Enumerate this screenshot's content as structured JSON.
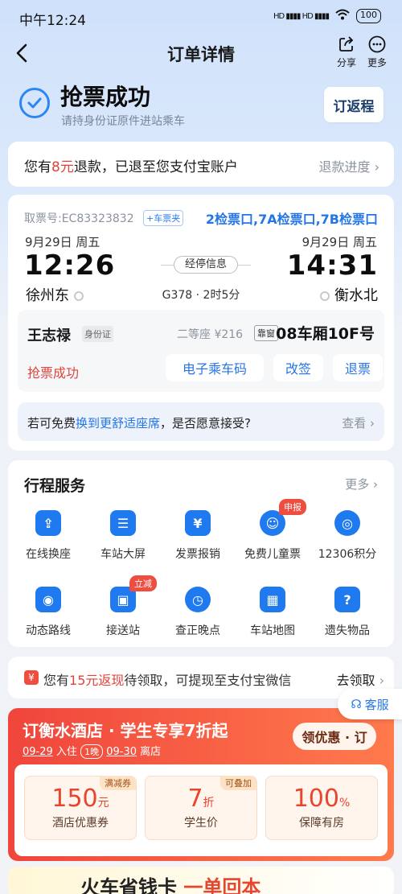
{
  "status_bar": {
    "time": "中午12:24",
    "signal": "HD ▮▮▮▮ HD ▮▮▮▮",
    "battery": "100"
  },
  "nav": {
    "title": "订单详情",
    "share": "分享",
    "more": "更多"
  },
  "header": {
    "title": "抢票成功",
    "subtitle": "请持身份证原件进站乘车",
    "return_button": "订返程"
  },
  "refund": {
    "prefix": "您有",
    "amount": "8元",
    "suffix": "退款，已退至您支付宝账户",
    "link": "退款进度"
  },
  "ticket": {
    "ticket_no": "取票号:EC83323832",
    "wallet_tag": "+车票夹",
    "gate": "2检票口,7A检票口,7B检票口",
    "depart": {
      "date": "9月29日  周五",
      "time": "12:26",
      "station": "徐州东"
    },
    "arrive": {
      "date": "9月29日  周五",
      "time": "14:31",
      "station": "衡水北"
    },
    "stops_label": "经停信息",
    "train_info": "G378 · 2时5分",
    "passenger": {
      "name": "王志禄",
      "id_type": "身份证",
      "seat_type": "二等座 ¥216",
      "window_tag": "靠窗",
      "seat_no": "08车厢10F号",
      "status": "抢票成功",
      "btn_eticket": "电子乘车码",
      "btn_change": "改签",
      "btn_refund": "退票"
    },
    "upgrade": {
      "pre": "若可免费",
      "highlight": "换到更舒适座席",
      "post": "，是否愿意接受?",
      "link": "查看"
    }
  },
  "services": {
    "title": "行程服务",
    "more": "更多",
    "items": [
      {
        "label": "在线换座",
        "icon": "seat-swap-icon",
        "glyph": "⇪"
      },
      {
        "label": "车站大屏",
        "icon": "station-screen-icon",
        "glyph": "☰"
      },
      {
        "label": "发票报销",
        "icon": "invoice-icon",
        "glyph": "¥"
      },
      {
        "label": "免费儿童票",
        "icon": "child-ticket-icon",
        "glyph": "☺",
        "badge": "申报"
      },
      {
        "label": "12306积分",
        "icon": "points-icon",
        "glyph": "◎"
      },
      {
        "label": "动态路线",
        "icon": "route-icon",
        "glyph": "◉"
      },
      {
        "label": "接送站",
        "icon": "car-icon",
        "glyph": "▣",
        "badge": "立减"
      },
      {
        "label": "查正晚点",
        "icon": "clock-icon",
        "glyph": "◷"
      },
      {
        "label": "车站地图",
        "icon": "map-icon",
        "glyph": "▦"
      },
      {
        "label": "遗失物品",
        "icon": "lost-item-icon",
        "glyph": "?"
      }
    ]
  },
  "cashback": {
    "icon_text": "¥",
    "pre": "您有",
    "amount": "15元返现",
    "post": "待领取，可提现至支付宝微信",
    "link": "去领取"
  },
  "customer_service": "客服",
  "hotel": {
    "title": "订衡水酒店 · 学生专享7折起",
    "checkin_date": "09-29",
    "checkin_label": "入住",
    "nights": "1晚",
    "checkout_date": "09-30",
    "checkout_label": "离店",
    "button": "领优惠 · 订",
    "coupons": [
      {
        "value": "150",
        "unit": "元",
        "name": "酒店优惠券",
        "tag": "满减券"
      },
      {
        "value": "7",
        "unit": "折",
        "name": "学生价",
        "tag": "可叠加"
      },
      {
        "value": "100",
        "unit": "%",
        "name": "保障有房",
        "tag": ""
      }
    ]
  },
  "promo_bottom": {
    "pre": "火车省钱卡",
    "highlight": "一单回本"
  }
}
